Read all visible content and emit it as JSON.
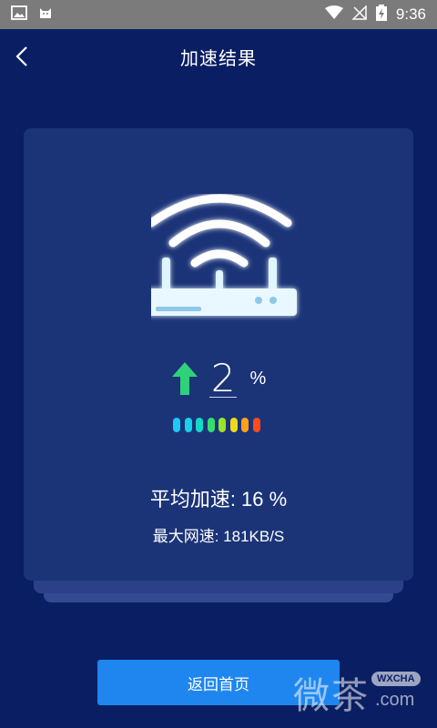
{
  "status_bar": {
    "time": "9:36",
    "icons": [
      "image-icon",
      "cat-icon",
      "wifi-icon",
      "no-signal-icon",
      "battery-charging-icon"
    ]
  },
  "header": {
    "title": "加速结果",
    "back_icon": "chevron-left-icon"
  },
  "result": {
    "speed_value": "2",
    "speed_unit": "%",
    "avg_text": "平均加速: 16 %",
    "max_text": "最大网速: 181KB/S",
    "bar_colors": [
      "#1ec8f5",
      "#17d2e8",
      "#14d9c5",
      "#35dc72",
      "#9be22a",
      "#f0d81c",
      "#ffa21a",
      "#ff4a1c"
    ]
  },
  "colors": {
    "background": "#0a1f63",
    "card": "#1b3478",
    "accent_button": "#1f86ef",
    "arrow_green": "#2fd17a"
  },
  "footer": {
    "home_button_label": "返回首页"
  },
  "watermark": {
    "chars": "微茶",
    "badge": "WXCHA",
    "dotcom": ".com"
  }
}
